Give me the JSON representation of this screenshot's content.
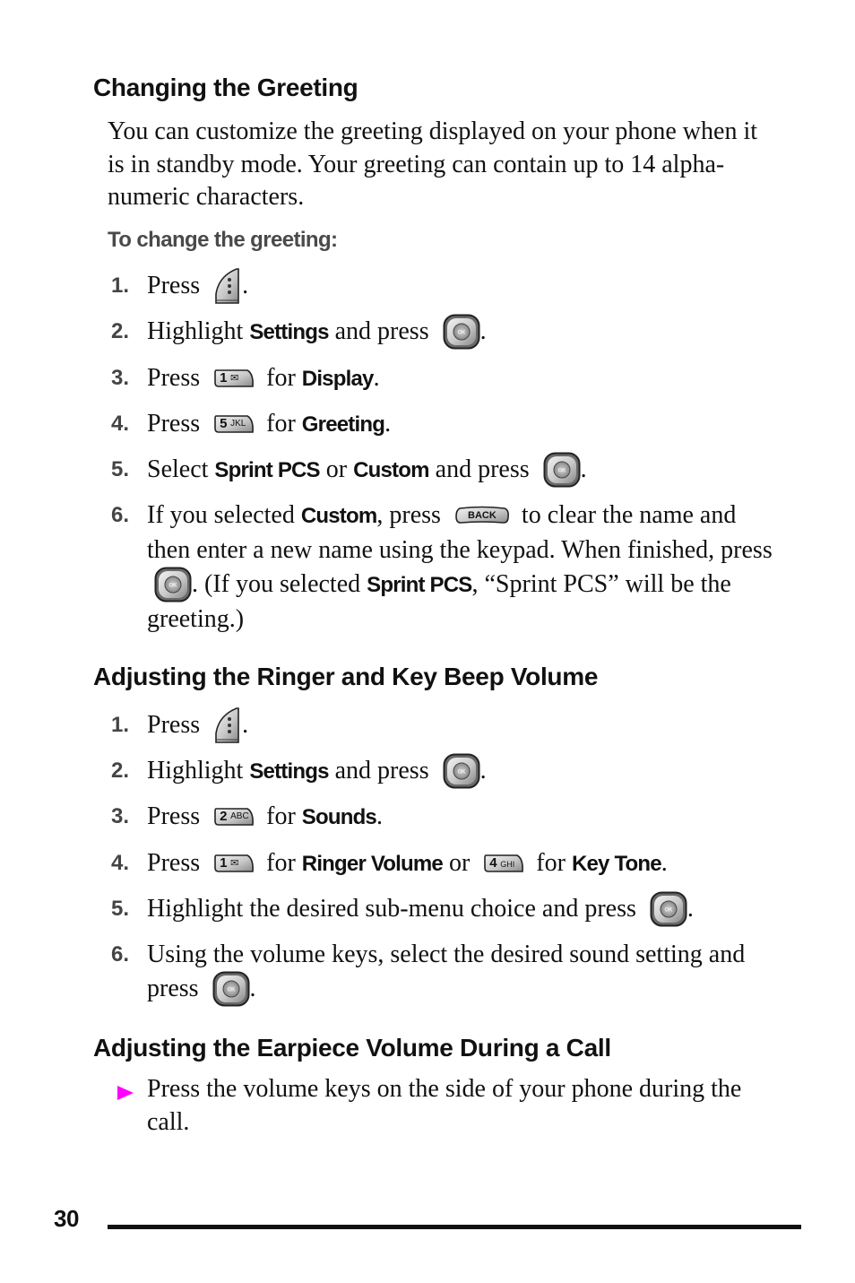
{
  "sections": {
    "greeting": {
      "heading": "Changing the Greeting",
      "intro": "You can customize the greeting displayed on your phone when it is in standby mode. Your greeting can contain up to 14 alpha-numeric characters.",
      "subheading": "To change the greeting:",
      "steps": [
        {
          "num": "1.",
          "t1": "Press ",
          "t2": "."
        },
        {
          "num": "2.",
          "t1": "Highlight ",
          "kw1": "Settings",
          "t2": " and press ",
          "t3": "."
        },
        {
          "num": "3.",
          "t1": "Press ",
          "t2": " for ",
          "kw1": "Display",
          "t3": "."
        },
        {
          "num": "4.",
          "t1": "Press ",
          "t2": " for ",
          "kw1": "Greeting",
          "t3": "."
        },
        {
          "num": "5.",
          "t1": "Select ",
          "kw1": "Sprint PCS",
          "t2": " or ",
          "kw2": "Custom",
          "t3": " and press ",
          "t4": "."
        },
        {
          "num": "6.",
          "t1": "If you selected ",
          "kw1": "Custom",
          "t2": ", press ",
          "t3": " to clear the name and then enter a new name using the keypad. When finished, press ",
          "t4": ". (If you selected ",
          "kw2": "Sprint PCS",
          "t5": ", “Sprint PCS” will be the greeting.)"
        }
      ]
    },
    "ringer": {
      "heading": "Adjusting the Ringer and Key Beep Volume",
      "steps": [
        {
          "num": "1.",
          "t1": "Press ",
          "t2": "."
        },
        {
          "num": "2.",
          "t1": "Highlight ",
          "kw1": "Settings",
          "t2": " and press ",
          "t3": "."
        },
        {
          "num": "3.",
          "t1": "Press ",
          "t2": " for ",
          "kw1": "Sounds",
          "t3": "."
        },
        {
          "num": "4.",
          "t1": "Press ",
          "t2": " for ",
          "kw1": "Ringer Volume",
          "t3": " or ",
          "t4": " for ",
          "kw2": "Key Tone",
          "t5": "."
        },
        {
          "num": "5.",
          "t1": "Highlight the desired sub-menu choice and press ",
          "t2": "."
        },
        {
          "num": "6.",
          "t1": "Using the volume keys, select the desired sound setting and press ",
          "t2": "."
        }
      ]
    },
    "earpiece": {
      "heading": "Adjusting the Earpiece Volume During a Call",
      "bullet": "Press the volume keys on the side of your phone during the call."
    }
  },
  "keys": {
    "ok": "OK",
    "back": "BACK",
    "k1": {
      "digit": "1",
      "letters": "✉"
    },
    "k2": {
      "digit": "2",
      "letters": "ABC"
    },
    "k4": {
      "digit": "4",
      "letters": "GHI"
    },
    "k5": {
      "digit": "5",
      "letters": "JKL"
    }
  },
  "colors": {
    "bullet": "#ff00ff",
    "text": "#111111",
    "subhead": "#4a4a4a"
  },
  "footer": {
    "page_number": "30"
  }
}
